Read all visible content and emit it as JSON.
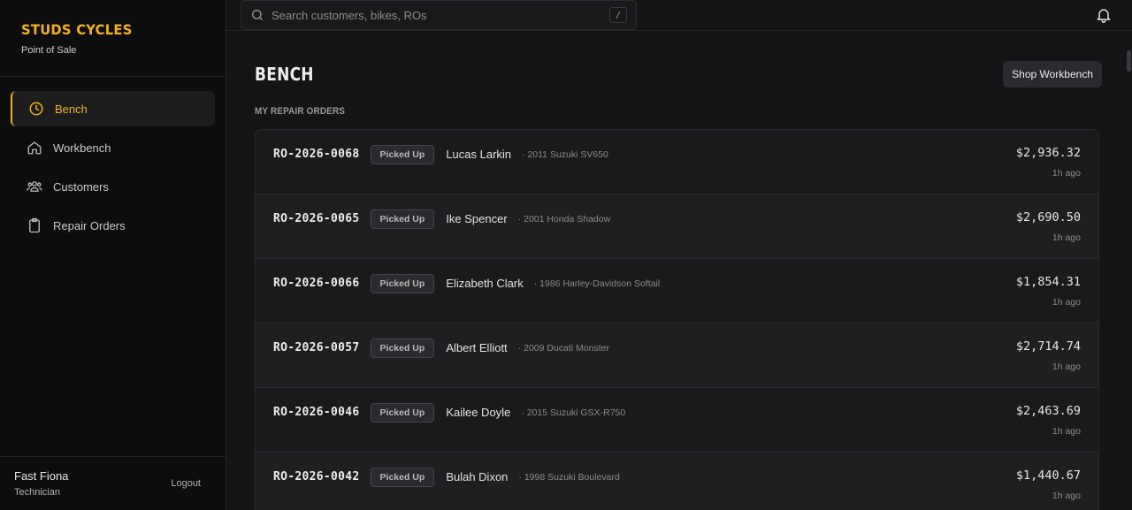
{
  "brand": {
    "name": "STUDS CYCLES",
    "subtitle": "Point of Sale"
  },
  "nav": [
    {
      "label": "Bench",
      "icon": "clock-icon",
      "active": true
    },
    {
      "label": "Workbench",
      "icon": "home-icon"
    },
    {
      "label": "Customers",
      "icon": "users-icon"
    },
    {
      "label": "Repair Orders",
      "icon": "clipboard-icon"
    }
  ],
  "user": {
    "name": "Fast Fiona",
    "role": "Technician",
    "logout_label": "Logout"
  },
  "search": {
    "placeholder": "Search customers, bikes, ROs",
    "shortcut": "/"
  },
  "page": {
    "title": "BENCH",
    "shop_button": "Shop Workbench",
    "section": "MY REPAIR ORDERS"
  },
  "colors": {
    "accent": "#f0b21a",
    "background": "#141416",
    "sidebar": "#0d0d0e"
  },
  "repair_orders": [
    {
      "id": "RO-2026-0068",
      "status": "Picked Up",
      "customer": "Lucas Larkin",
      "bike": "· 2011 Suzuki SV650",
      "amount": "$2,936.32",
      "ago": "1h ago"
    },
    {
      "id": "RO-2026-0065",
      "status": "Picked Up",
      "customer": "Ike Spencer",
      "bike": "· 2001 Honda Shadow",
      "amount": "$2,690.50",
      "ago": "1h ago"
    },
    {
      "id": "RO-2026-0066",
      "status": "Picked Up",
      "customer": "Elizabeth Clark",
      "bike": "· 1986 Harley-Davidson Softail",
      "amount": "$1,854.31",
      "ago": "1h ago"
    },
    {
      "id": "RO-2026-0057",
      "status": "Picked Up",
      "customer": "Albert Elliott",
      "bike": "· 2009 Ducati Monster",
      "amount": "$2,714.74",
      "ago": "1h ago"
    },
    {
      "id": "RO-2026-0046",
      "status": "Picked Up",
      "customer": "Kailee Doyle",
      "bike": "· 2015 Suzuki GSX-R750",
      "amount": "$2,463.69",
      "ago": "1h ago"
    },
    {
      "id": "RO-2026-0042",
      "status": "Picked Up",
      "customer": "Bulah Dixon",
      "bike": "· 1998 Suzuki Boulevard",
      "amount": "$1,440.67",
      "ago": "1h ago"
    }
  ]
}
